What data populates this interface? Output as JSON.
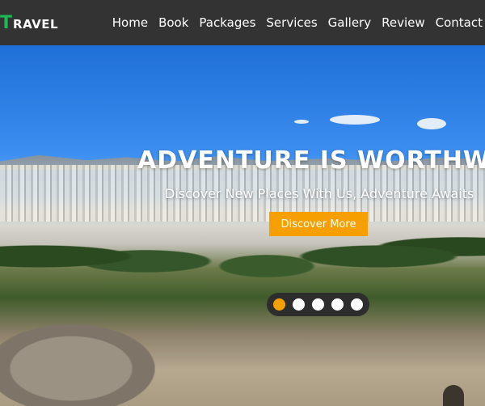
{
  "brand": {
    "initial": "T",
    "rest": "RAVEL",
    "initial_color": "#1db954"
  },
  "nav": {
    "items": [
      {
        "label": "Home"
      },
      {
        "label": "Book"
      },
      {
        "label": "Packages"
      },
      {
        "label": "Services"
      },
      {
        "label": "Gallery"
      },
      {
        "label": "Review"
      },
      {
        "label": "Contact"
      }
    ]
  },
  "hero": {
    "title": "ADVENTURE IS WORTHWHIL",
    "subtitle": "Discover New Places With Us, Adventure Awaits",
    "cta_label": "Discover More"
  },
  "carousel": {
    "dot_count": 5,
    "active_index": 0,
    "active_color": "#f5a000"
  },
  "colors": {
    "navbar_bg": "#333333",
    "accent": "#f5a000"
  }
}
